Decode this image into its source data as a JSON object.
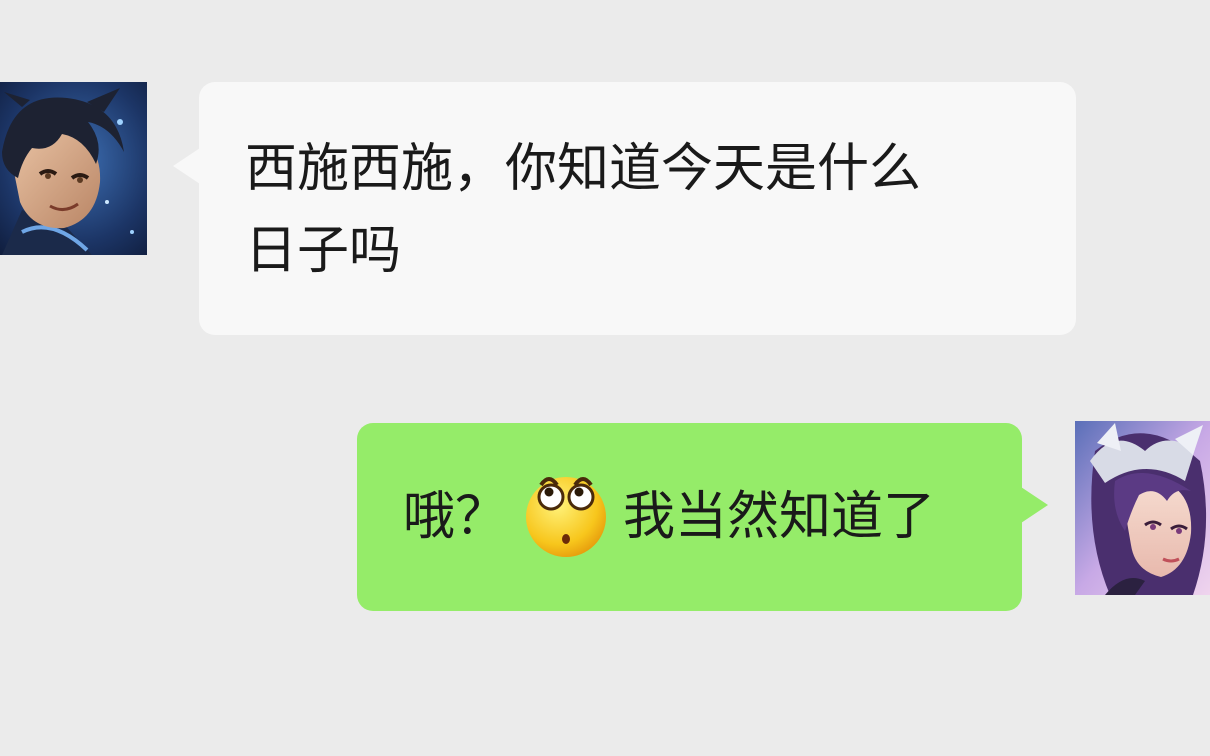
{
  "messages": [
    {
      "direction": "incoming",
      "lines": [
        "西施西施，你知道今天是什么",
        "日子吗"
      ]
    },
    {
      "direction": "outgoing",
      "text_before_emoji": "哦？",
      "emoji": "rolling-eyes-emoji",
      "text_after_emoji": "我当然知道了"
    }
  ],
  "colors": {
    "background": "#ebebeb",
    "incoming_bubble": "#f8f8f8",
    "outgoing_bubble": "#95ec69",
    "text": "#1a1a1a"
  },
  "avatars": {
    "left": "male-hero-avatar",
    "right": "xishi-avatar"
  }
}
